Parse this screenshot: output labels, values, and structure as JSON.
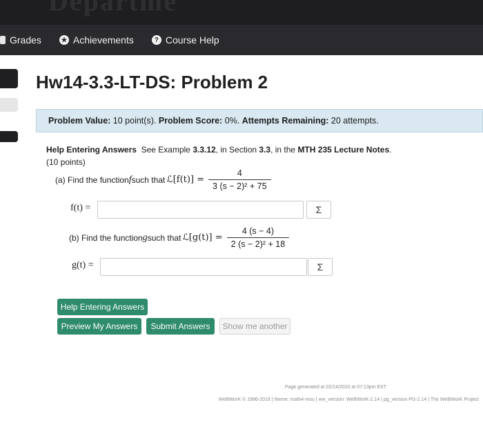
{
  "banner": {
    "partial_text": "Departme"
  },
  "nav": {
    "items": [
      {
        "label": "Grades",
        "icon": "grades-icon"
      },
      {
        "label": "Achievements",
        "icon": "star-icon"
      },
      {
        "label": "Course Help",
        "icon": "help-icon"
      }
    ]
  },
  "title": "Hw14-3.3-LT-DS: Problem 2",
  "info": {
    "value_label": "Problem Value:",
    "value": "10 point(s).",
    "score_label": "Problem Score:",
    "score": "0%.",
    "attempts_label": "Attempts Remaining:",
    "attempts": "20 attempts."
  },
  "problem": {
    "help_label": "Help Entering Answers",
    "see_prefix": "See Example ",
    "example": "3.3.12",
    "in_section": ", in Section ",
    "section": "3.3",
    "in_the": ", in the ",
    "notes": "MTH 235 Lecture Notes",
    "period": ".",
    "points": "(10 points)",
    "part_a": {
      "prefix": "(a) Find the function ",
      "var": "f",
      "mid": " such that ",
      "lhs": "ℒ[f(t)] =",
      "num": "4",
      "den": "3 (s − 2)² + 75",
      "answer_label": "f(t) =",
      "answer_value": ""
    },
    "part_b": {
      "prefix": "(b) Find the function ",
      "var": "g",
      "mid": " such that ",
      "lhs": "ℒ[g(t)] =",
      "num": "4 (s − 4)",
      "den": "2 (s − 2)² + 18",
      "answer_label": "g(t) =",
      "answer_value": ""
    },
    "sigma": "Σ"
  },
  "buttons": {
    "help": "Help Entering Answers",
    "preview": "Preview My Answers",
    "submit": "Submit Answers",
    "show_another": "Show me another"
  },
  "footer": {
    "generated": "Page generated at 02/14/2020 at 07:13pm EST",
    "copyright": "WeBWorK © 1996-2019 | theme: math4-msu | ww_version: WeBWorK-2.14 | pg_version PG-2.14 | The WeBWorK Project"
  },
  "colors": {
    "nav_bg": "#2a2a2e",
    "info_bg": "#d9e8f1",
    "button_green": "#2e8b6c"
  }
}
